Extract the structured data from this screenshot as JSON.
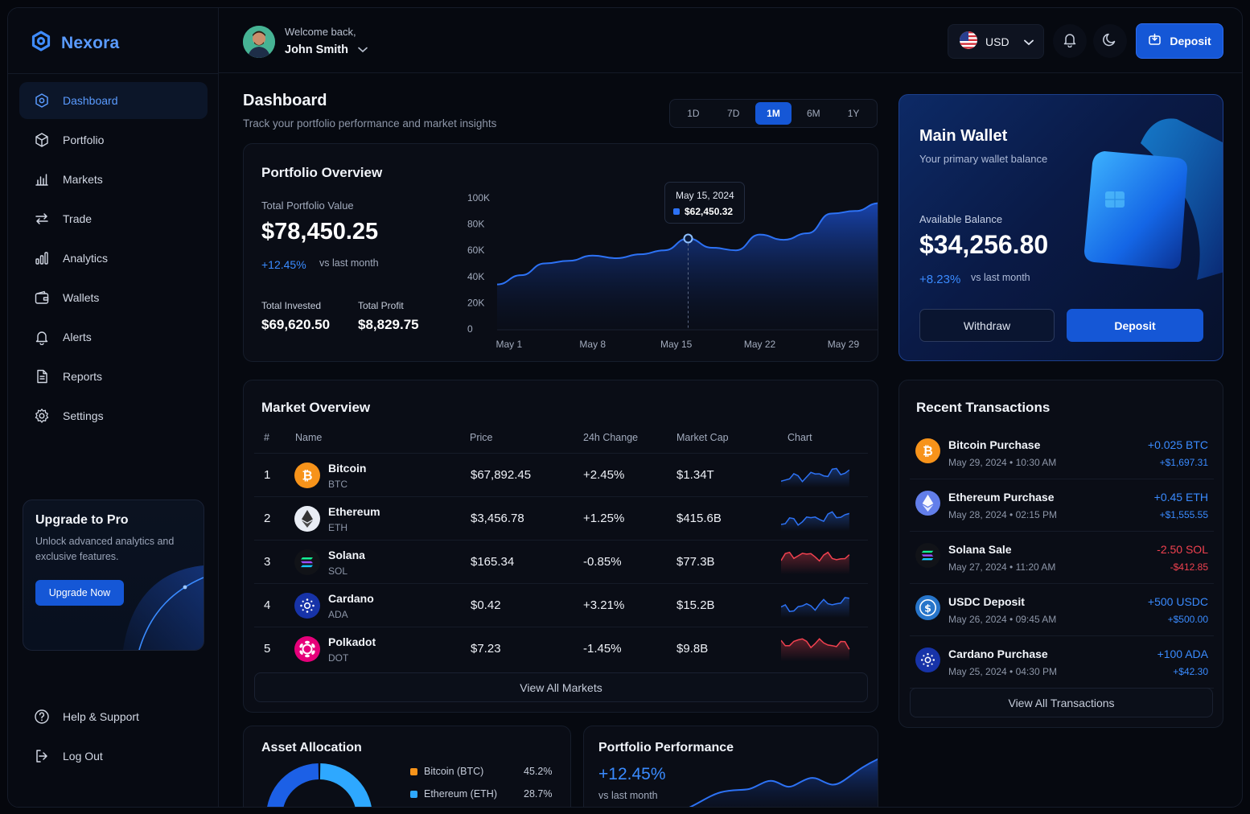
{
  "brand": {
    "name": "Nexora"
  },
  "sidebar": {
    "items": [
      {
        "label": "Dashboard",
        "icon": "dashboard-icon",
        "active": true
      },
      {
        "label": "Portfolio",
        "icon": "portfolio-icon"
      },
      {
        "label": "Markets",
        "icon": "markets-icon"
      },
      {
        "label": "Trade",
        "icon": "trade-icon"
      },
      {
        "label": "Analytics",
        "icon": "analytics-icon"
      },
      {
        "label": "Wallets",
        "icon": "wallet-icon"
      },
      {
        "label": "Alerts",
        "icon": "bell-icon"
      },
      {
        "label": "Reports",
        "icon": "reports-icon"
      },
      {
        "label": "Settings",
        "icon": "gear-icon"
      }
    ],
    "promo": {
      "title": "Upgrade to Pro",
      "text": "Unlock advanced analytics and exclusive features.",
      "button": "Upgrade Now"
    },
    "bottom": [
      {
        "label": "Help & Support",
        "icon": "help-icon"
      },
      {
        "label": "Log Out",
        "icon": "logout-icon"
      }
    ]
  },
  "header": {
    "welcome": "Welcome back,",
    "user_name": "John Smith",
    "currency": "USD",
    "deposit": "Deposit"
  },
  "page": {
    "title": "Dashboard",
    "subtitle": "Track your portfolio performance and market insights",
    "ranges": [
      "1D",
      "7D",
      "1M",
      "6M",
      "1Y"
    ],
    "active_range": "1M"
  },
  "portfolio": {
    "title": "Portfolio Overview",
    "total_label": "Total Portfolio Value",
    "total_value": "$78,450.25",
    "change": "+12.45%",
    "change_note": "vs last month",
    "invested_label": "Total Invested",
    "invested_value": "$69,620.50",
    "profit_label": "Total Profit",
    "profit_value": "$8,829.75",
    "tooltip_date": "May 15, 2024",
    "tooltip_value": "$62,450.32"
  },
  "chart_data": {
    "type": "area",
    "title": "",
    "y_ticks": [
      "100K",
      "80K",
      "60K",
      "40K",
      "20K",
      "0"
    ],
    "x_ticks": [
      "May 1",
      "May 8",
      "May 15",
      "May 22",
      "May 29"
    ],
    "ylim": [
      0,
      100000
    ],
    "x": [
      0,
      2,
      4,
      6,
      8,
      10,
      12,
      14,
      16,
      18,
      20,
      22,
      24,
      26,
      28,
      30,
      32
    ],
    "values": [
      34000,
      41000,
      50000,
      52000,
      56000,
      54000,
      57000,
      60000,
      69000,
      62000,
      60000,
      72000,
      68000,
      73000,
      88000,
      90000,
      96000
    ]
  },
  "market": {
    "title": "Market Overview",
    "headers": [
      "#",
      "Name",
      "Price",
      "24h Change",
      "Market Cap",
      "Chart"
    ],
    "rows": [
      {
        "rank": "1",
        "name": "Bitcoin",
        "symbol": "BTC",
        "price": "$67,892.45",
        "change": "+2.45%",
        "cap": "$1.34T",
        "dir": "up",
        "logo": "bitcoin-icon",
        "color": "#f7931a"
      },
      {
        "rank": "2",
        "name": "Ethereum",
        "symbol": "ETH",
        "price": "$3,456.78",
        "change": "+1.25%",
        "cap": "$415.6B",
        "dir": "up",
        "logo": "ethereum-icon",
        "color": "#e9edf5"
      },
      {
        "rank": "3",
        "name": "Solana",
        "symbol": "SOL",
        "price": "$165.34",
        "change": "-0.85%",
        "cap": "$77.3B",
        "dir": "down",
        "logo": "solana-icon",
        "color": "#111318"
      },
      {
        "rank": "4",
        "name": "Cardano",
        "symbol": "ADA",
        "price": "$0.42",
        "change": "+3.21%",
        "cap": "$15.2B",
        "dir": "up",
        "logo": "cardano-icon",
        "color": "#1733a8"
      },
      {
        "rank": "5",
        "name": "Polkadot",
        "symbol": "DOT",
        "price": "$7.23",
        "change": "-1.45%",
        "cap": "$9.8B",
        "dir": "down",
        "logo": "polkadot-icon",
        "color": "#e6007a"
      }
    ],
    "view_all": "View All Markets"
  },
  "wallet": {
    "title": "Main Wallet",
    "subtitle": "Your primary wallet balance",
    "balance_label": "Available Balance",
    "balance": "$34,256.80",
    "change": "+8.23%",
    "change_note": "vs last month",
    "withdraw": "Withdraw",
    "deposit": "Deposit"
  },
  "transactions": {
    "title": "Recent Transactions",
    "items": [
      {
        "name": "Bitcoin Purchase",
        "date": "May 29, 2024 • 10:30 AM",
        "amount": "+0.025 BTC",
        "usd": "+$1,697.31",
        "dir": "up",
        "logo": "bitcoin-icon",
        "color": "#f7931a"
      },
      {
        "name": "Ethereum Purchase",
        "date": "May 28, 2024 • 02:15 PM",
        "amount": "+0.45 ETH",
        "usd": "+$1,555.55",
        "dir": "up",
        "logo": "ethereum-icon",
        "color": "#627eea"
      },
      {
        "name": "Solana Sale",
        "date": "May 27, 2024 • 11:20 AM",
        "amount": "-2.50 SOL",
        "usd": "-$412.85",
        "dir": "down",
        "logo": "solana-icon",
        "color": "#111318"
      },
      {
        "name": "USDC Deposit",
        "date": "May 26, 2024 • 09:45 AM",
        "amount": "+500 USDC",
        "usd": "+$500.00",
        "dir": "up",
        "logo": "usdc-icon",
        "color": "#2775ca"
      },
      {
        "name": "Cardano Purchase",
        "date": "May 25, 2024 • 04:30 PM",
        "amount": "+100 ADA",
        "usd": "+$42.30",
        "dir": "up",
        "logo": "cardano-icon",
        "color": "#1733a8"
      }
    ],
    "view_all": "View All Transactions"
  },
  "allocation": {
    "title": "Asset Allocation",
    "items": [
      {
        "name": "Bitcoin (BTC)",
        "pct": "45.2%",
        "value": 45.2,
        "color": "#f7931a"
      },
      {
        "name": "Ethereum (ETH)",
        "pct": "28.7%",
        "value": 28.7,
        "color": "#2ea8ff"
      }
    ]
  },
  "performance": {
    "title": "Portfolio Performance",
    "change": "+12.45%",
    "change_note": "vs last month"
  },
  "colors": {
    "accent": "#1557d6",
    "positive": "#3a8bff",
    "negative": "#f0414f",
    "background": "#060910"
  }
}
